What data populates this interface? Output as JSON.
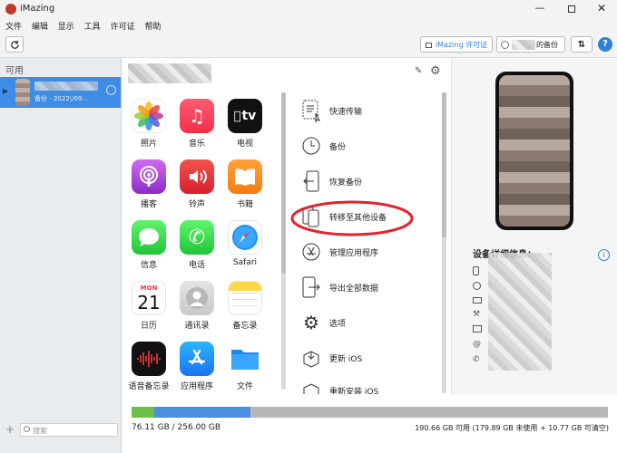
{
  "window": {
    "title": "iMazing"
  },
  "menu": [
    "文件",
    "编辑",
    "显示",
    "工具",
    "许可证",
    "帮助"
  ],
  "toolbar": {
    "license_label": "iMazing 许可证",
    "backup_label": "的备份"
  },
  "sidebar": {
    "section": "可用",
    "device_subtitle": "备份 - 2022\\/09...",
    "search_placeholder": "搜索"
  },
  "apps": [
    {
      "label": "照片",
      "icon": "photos-icon"
    },
    {
      "label": "音乐",
      "icon": "music-icon"
    },
    {
      "label": "电视",
      "icon": "tv-icon"
    },
    {
      "label": "播客",
      "icon": "podcasts-icon"
    },
    {
      "label": "铃声",
      "icon": "ringtones-icon"
    },
    {
      "label": "书籍",
      "icon": "books-icon"
    },
    {
      "label": "信息",
      "icon": "messages-icon"
    },
    {
      "label": "电话",
      "icon": "phone-icon"
    },
    {
      "label": "Safari",
      "icon": "safari-icon"
    },
    {
      "label": "日历",
      "icon": "calendar-icon"
    },
    {
      "label": "通讯录",
      "icon": "contacts-icon"
    },
    {
      "label": "备忘录",
      "icon": "notes-icon"
    },
    {
      "label": "语音备忘录",
      "icon": "voice-memos-icon"
    },
    {
      "label": "应用程序",
      "icon": "app-store-icon"
    },
    {
      "label": "文件",
      "icon": "files-icon"
    }
  ],
  "calendar": {
    "month": "MON",
    "day": "21"
  },
  "tv_label": "tv",
  "actions": [
    {
      "label": "快速传输",
      "icon": "quick-transfer-icon"
    },
    {
      "label": "备份",
      "icon": "backup-icon"
    },
    {
      "label": "恢复备份",
      "icon": "restore-backup-icon"
    },
    {
      "label": "转移至其他设备",
      "icon": "transfer-device-icon"
    },
    {
      "label": "管理应用程序",
      "icon": "manage-apps-icon"
    },
    {
      "label": "导出全部数据",
      "icon": "export-data-icon"
    },
    {
      "label": "选项",
      "icon": "options-icon"
    },
    {
      "label": "更新 iOS",
      "icon": "update-ios-icon"
    },
    {
      "label": "重新安装 iOS",
      "icon": "reinstall-ios-icon"
    }
  ],
  "details": {
    "title": "设备详细信息："
  },
  "storage": {
    "used_text": "76.11 GB / 256.00 GB",
    "free_text": "190.66 GB 可用 (179.89 GB 未使用 + 10.77 GB 可清空)",
    "green_fraction": 0.047,
    "blue_fraction": 0.25
  },
  "colors": {
    "accent": "#2f7fd6",
    "highlight_circle": "#e5212a",
    "selected_row": "#3d8de6"
  }
}
